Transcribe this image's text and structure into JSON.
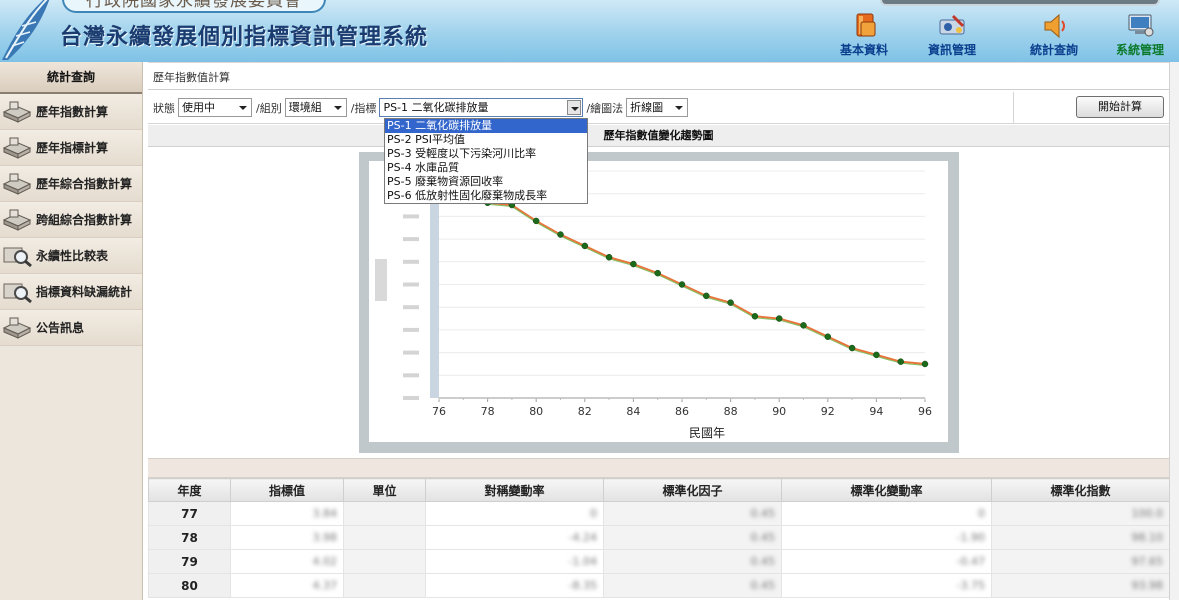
{
  "header": {
    "org_name": "行政院國家永續發展委員會",
    "system_title": "台灣永續發展個別指標資訊管理系統",
    "nav": [
      {
        "label": "基本資料",
        "icon": "book-icon",
        "active": false
      },
      {
        "label": "資訊管理",
        "icon": "tools-icon",
        "active": false
      },
      {
        "label": "統計查詢",
        "icon": "speaker-icon",
        "active": false
      },
      {
        "label": "系統管理",
        "icon": "computer-icon",
        "active": true
      }
    ]
  },
  "sidebar": {
    "heading": "統計查詢",
    "items": [
      {
        "label": "歷年指數計算",
        "icon": "blocks-icon"
      },
      {
        "label": "歷年指標計算",
        "icon": "blocks-icon"
      },
      {
        "label": "歷年綜合指數計算",
        "icon": "blocks-icon"
      },
      {
        "label": "跨組綜合指數計算",
        "icon": "blocks-icon"
      },
      {
        "label": "永續性比較表",
        "icon": "magnifier-icon"
      },
      {
        "label": "指標資料缺漏統計",
        "icon": "magnifier-icon"
      },
      {
        "label": "公告訊息",
        "icon": "blocks-icon"
      }
    ]
  },
  "breadcrumb": "歷年指數值計算",
  "toolbar": {
    "status_label": "狀態",
    "status_value": "使用中",
    "group_label": "/組別",
    "group_value": "環境組",
    "indicator_label": "/指標",
    "indicator_value": "PS-1 二氧化碳排放量",
    "chart_method_label": "/繪圖法",
    "chart_method_value": "折線圖",
    "calc_button": "開始計算"
  },
  "indicator_options": [
    "PS-1 二氧化碳排放量",
    "PS-2 PSI平均值",
    "PS-3 受輕度以下污染河川比率",
    "PS-4 水庫品質",
    "PS-5 廢棄物資源回收率",
    "PS-6 低放射性固化廢棄物成長率"
  ],
  "chart_section_title": "歷年指數值變化趨勢圖",
  "chart_data": {
    "type": "line",
    "title": "",
    "xlabel": "民國年",
    "ylabel": "",
    "x_ticks": [
      "76",
      "78",
      "80",
      "82",
      "84",
      "86",
      "88",
      "90",
      "92",
      "94",
      "96"
    ],
    "xlim": [
      76,
      96
    ],
    "ylim": [
      0,
      100
    ],
    "grid": "horizontal",
    "series": [
      {
        "color": "#e8743b",
        "marker_color": "#1b6b1b",
        "x": [
          76,
          77,
          78,
          79,
          80,
          81,
          82,
          83,
          84,
          85,
          86,
          87,
          88,
          89,
          90,
          91,
          92,
          93,
          94,
          95,
          96
        ],
        "y": [
          98,
          94,
          86,
          85,
          78,
          72,
          67,
          62,
          59,
          55,
          50,
          45,
          42,
          36,
          35,
          32,
          27,
          22,
          19,
          16,
          15
        ]
      }
    ]
  },
  "table": {
    "headers": [
      "年度",
      "指標值",
      "單位",
      "對稱變動率",
      "標準化因子",
      "標準化變動率",
      "標準化指數"
    ],
    "rows": [
      {
        "year": "77",
        "cells": [
          "3.84",
          "",
          "0",
          "0.45",
          "0",
          "100.0"
        ]
      },
      {
        "year": "78",
        "cells": [
          "3.98",
          "",
          "-4.24",
          "0.45",
          "-1.90",
          "98.10"
        ]
      },
      {
        "year": "79",
        "cells": [
          "4.02",
          "",
          "-1.04",
          "0.45",
          "-0.47",
          "97.65"
        ]
      },
      {
        "year": "80",
        "cells": [
          "4.37",
          "",
          "-8.35",
          "0.45",
          "-3.75",
          "93.98"
        ]
      }
    ]
  }
}
